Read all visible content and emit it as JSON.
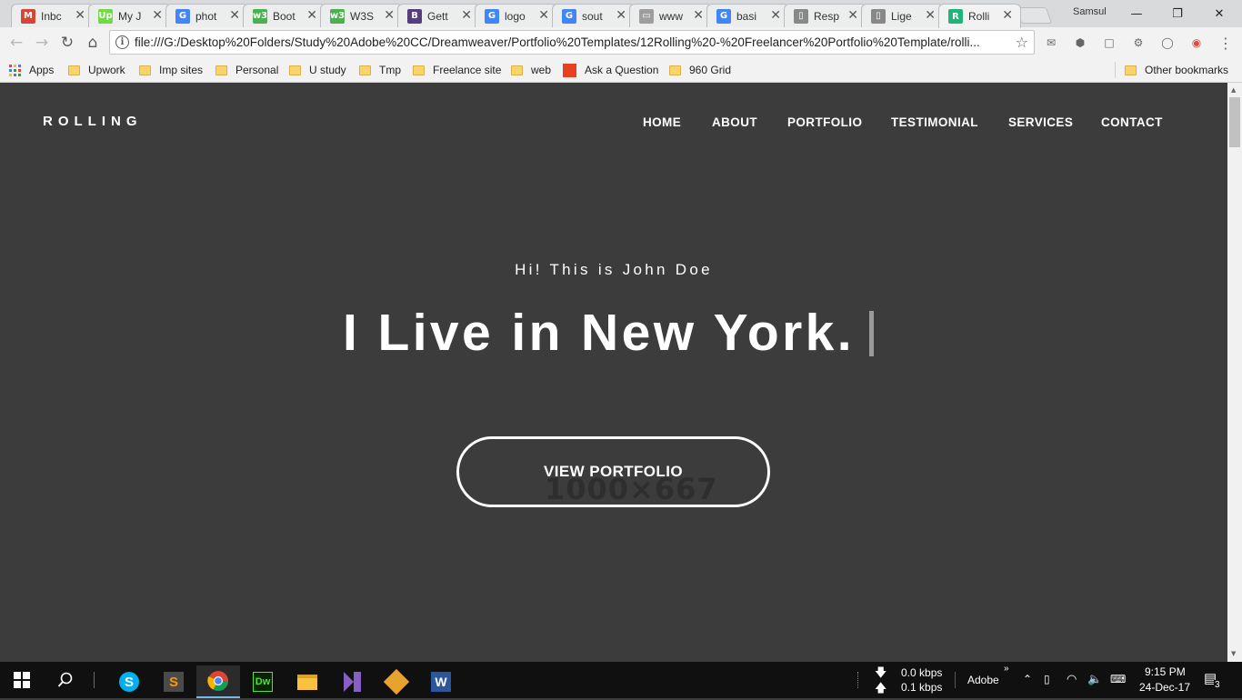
{
  "browser": {
    "tabs": [
      {
        "label": "Inbc",
        "icon": "gmail-icon",
        "color": "#d44638",
        "glyph": "M"
      },
      {
        "label": "My J",
        "icon": "upwork-icon",
        "color": "#6fda44",
        "glyph": "Up"
      },
      {
        "label": "phot",
        "icon": "google-icon",
        "color": "#4285f4",
        "glyph": "G"
      },
      {
        "label": "Boot",
        "icon": "w3schools-icon",
        "color": "#4caf50",
        "glyph": "w3"
      },
      {
        "label": "W3S",
        "icon": "w3schools-icon",
        "color": "#4caf50",
        "glyph": "w3"
      },
      {
        "label": "Gett",
        "icon": "bootstrap-icon",
        "color": "#563d7c",
        "glyph": "B"
      },
      {
        "label": "logo",
        "icon": "google-icon",
        "color": "#4285f4",
        "glyph": "G"
      },
      {
        "label": "sout",
        "icon": "google-icon",
        "color": "#4285f4",
        "glyph": "G"
      },
      {
        "label": "www",
        "icon": "image-icon",
        "color": "#9e9e9e",
        "glyph": "▭"
      },
      {
        "label": "basi",
        "icon": "google-icon",
        "color": "#4285f4",
        "glyph": "G"
      },
      {
        "label": "Resp",
        "icon": "page-icon",
        "color": "#888888",
        "glyph": "▯"
      },
      {
        "label": "Lige",
        "icon": "page-icon",
        "color": "#888888",
        "glyph": "▯"
      },
      {
        "label": "Rolli",
        "icon": "rolling-icon",
        "color": "#1fb47a",
        "glyph": "R"
      }
    ],
    "profile_name": "Samsul",
    "url": "file:///G:/Desktop%20Folders/Study%20Adobe%20CC/Dreamweaver/Portfolio%20Templates/12Rolling%20-%20Freelancer%20Portfolio%20Template/rolli...",
    "bookmarks": [
      "Apps",
      "Upwork",
      "Imp sites",
      "Personal",
      "U study",
      "Tmp",
      "Freelance site",
      "web",
      "Ask a Question",
      "960 Grid"
    ],
    "other_bookmarks": "Other bookmarks"
  },
  "site": {
    "logo": "ROLLING",
    "nav": [
      "HOME",
      "ABOUT",
      "PORTFOLIO",
      "TESTIMONIAL",
      "SERVICES",
      "CONTACT"
    ],
    "greeting": "Hi! This is John Doe",
    "headline": "I Live in New York.",
    "cta_label": "VIEW PORTFOLIO",
    "placeholder_text": "1000×667"
  },
  "taskbar": {
    "network_down": "0.0 kbps",
    "network_up": "0.1 kbps",
    "adobe_label": "Adobe",
    "time": "9:15 PM",
    "date": "24-Dec-17",
    "notification_count": "3"
  }
}
